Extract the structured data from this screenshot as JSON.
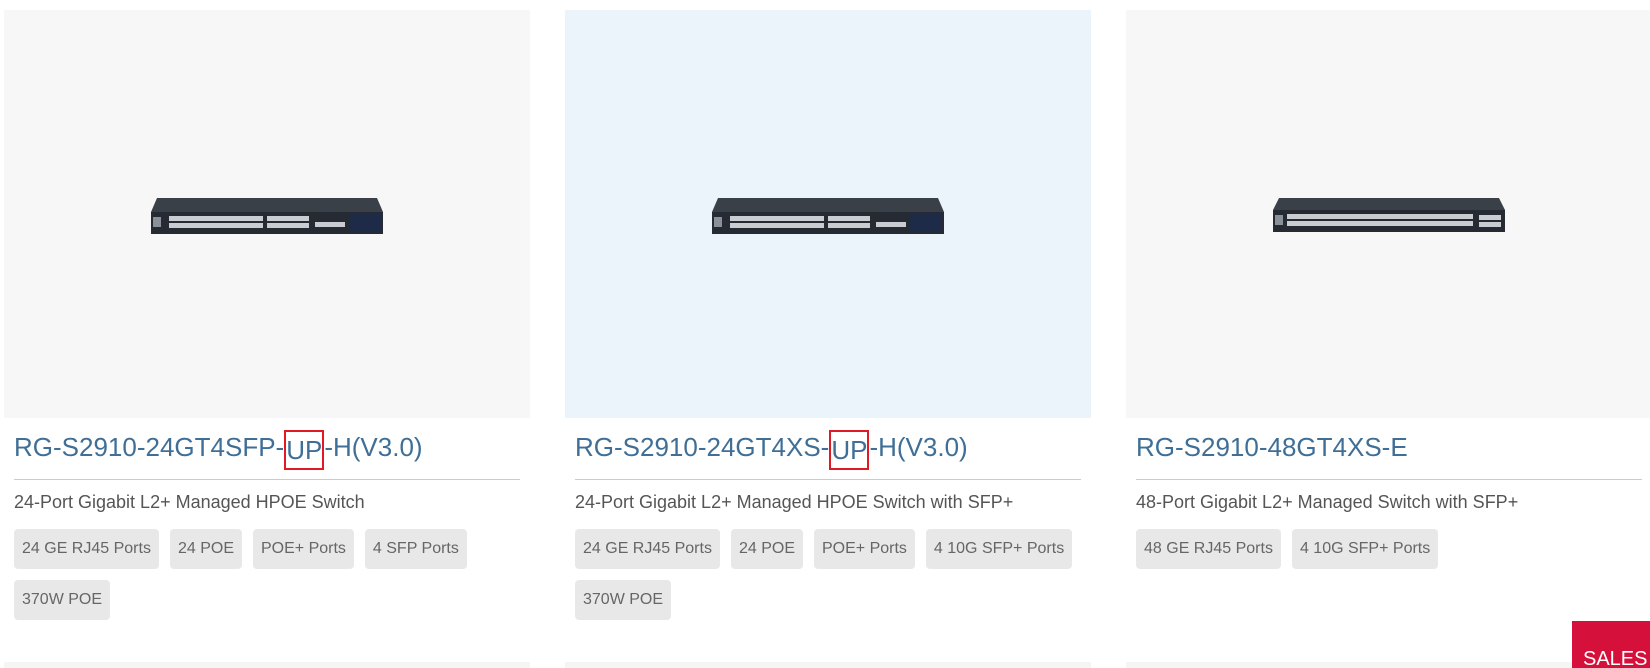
{
  "products": [
    {
      "image": "switch-24-port-icon",
      "title_prefix": "RG-S2910-24GT4SFP-",
      "title_highlight": "UP",
      "title_suffix": "-H(V3.0)",
      "description": "24-Port Gigabit L2+ Managed HPOE Switch",
      "tags": [
        "24 GE RJ45 Ports",
        "24 POE",
        "POE+ Ports",
        "4 SFP Ports",
        "370W POE"
      ]
    },
    {
      "image": "switch-24-port-icon",
      "title_prefix": "RG-S2910-24GT4XS-",
      "title_highlight": "UP",
      "title_suffix": "-H(V3.0)",
      "description": "24-Port Gigabit L2+ Managed HPOE Switch with SFP+",
      "tags": [
        "24 GE RJ45 Ports",
        "24 POE",
        "POE+ Ports",
        "4 10G SFP+ Ports",
        "370W POE"
      ]
    },
    {
      "image": "switch-48-port-icon",
      "title_prefix": "RG-S2910-48GT4XS-E",
      "title_highlight": "",
      "title_suffix": "",
      "description": "48-Port Gigabit L2+ Managed Switch with SFP+",
      "tags": [
        "48 GE RJ45 Ports",
        "4 10G SFP+ Ports"
      ]
    }
  ],
  "sales_button": {
    "label": "SALES"
  },
  "colors": {
    "title": "#3f6e96",
    "highlight_box": "#e01a22",
    "card_bg": "#f7f7f7",
    "card_bg_hover": "#ebf4fa",
    "tag_bg": "#e8e8e8",
    "sales_bg": "#d5113b"
  }
}
